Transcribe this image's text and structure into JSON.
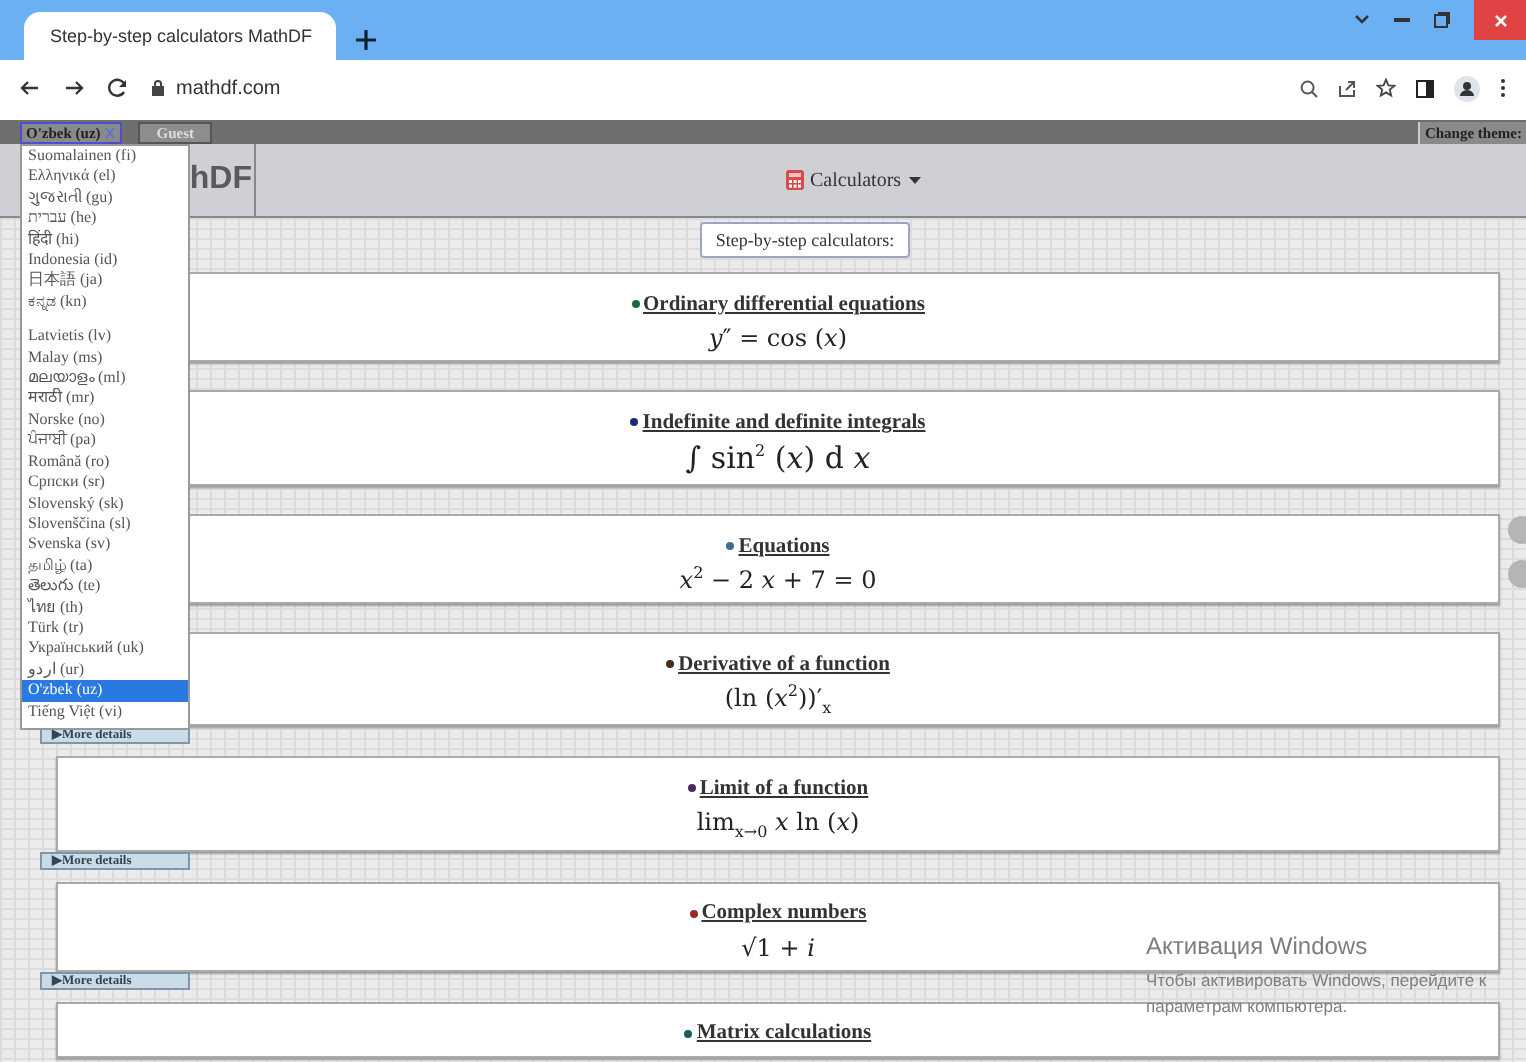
{
  "browser": {
    "tab_title": "Step-by-step calculators MathDF",
    "address": "mathdf.com"
  },
  "top_bar": {
    "language": "O'zbek (uz)",
    "guest": "Guest",
    "change_theme": "Change theme:"
  },
  "header": {
    "logo": "hDF",
    "menu": "Calculators"
  },
  "intro_button": "Step-by-step calculators:",
  "cards": [
    {
      "title": "Ordinary differential equations",
      "formula": "*y*″ = cos (*x*)",
      "color": "#1a6b3a"
    },
    {
      "title": "Indefinite and definite integrals",
      "formula": "∫ sin$^{2}$ (*x*) d *x*",
      "color": "#1d2a6b"
    },
    {
      "title": "Equations",
      "formula": "*x*$^{2}$ − 2 *x* + 7 = 0",
      "color": "#3c6f8a"
    },
    {
      "title": "Derivative of a function",
      "formula": "(ln (*x*$^{2}$))′$_{x}$",
      "color": "#4a2a1a",
      "more_details": "▶More details"
    },
    {
      "title": "Limit of a function",
      "formula": "lim$_{x→0}$ *x* ln (*x*)",
      "color": "#4a2a5a",
      "more_details": "▶More details"
    },
    {
      "title": "Complex numbers",
      "formula": "√1 + *i*",
      "color": "#9a2a2a",
      "more_details": "▶More details"
    },
    {
      "title": "Matrix calculations",
      "color": "#1a5a5a"
    }
  ],
  "language_menu": [
    {
      "label": "Suomalainen (fi)",
      "selected": false
    },
    {
      "label": "Ελληνικά (el)",
      "selected": false
    },
    {
      "label": "ગુજરાતી (gu)",
      "selected": false
    },
    {
      "label": "עברית (he)",
      "selected": false
    },
    {
      "label": "हिंदी (hi)",
      "selected": false
    },
    {
      "label": "Indonesia (id)",
      "selected": false
    },
    {
      "label": "日本語 (ja)",
      "selected": false
    },
    {
      "label": "ಕನ್ನಡ (kn)",
      "selected": false
    },
    {
      "label": "Latvietis (lv)",
      "selected": false
    },
    {
      "label": "Malay (ms)",
      "selected": false
    },
    {
      "label": "മലയാളം (ml)",
      "selected": false
    },
    {
      "label": "मराठी (mr)",
      "selected": false
    },
    {
      "label": "Norske (no)",
      "selected": false
    },
    {
      "label": "ਪੰਜਾਬੀ (pa)",
      "selected": false
    },
    {
      "label": "Română (ro)",
      "selected": false
    },
    {
      "label": "Српски (sr)",
      "selected": false
    },
    {
      "label": "Slovenský (sk)",
      "selected": false
    },
    {
      "label": "Slovenščina (sl)",
      "selected": false
    },
    {
      "label": "Svenska (sv)",
      "selected": false
    },
    {
      "label": "தமிழ் (ta)",
      "selected": false
    },
    {
      "label": "తెలుగు (te)",
      "selected": false
    },
    {
      "label": "ไทย (th)",
      "selected": false
    },
    {
      "label": "Türk (tr)",
      "selected": false
    },
    {
      "label": "Український (uk)",
      "selected": false
    },
    {
      "label": "اردو (ur)",
      "selected": false
    },
    {
      "label": "O'zbek (uz)",
      "selected": true
    },
    {
      "label": "Tiếng Việt (vi)",
      "selected": false
    }
  ],
  "os_notice": {
    "title": "Активация Windows",
    "text": "Чтобы активировать Windows, перейдите к",
    "text_2": "параметрам компьютера."
  }
}
